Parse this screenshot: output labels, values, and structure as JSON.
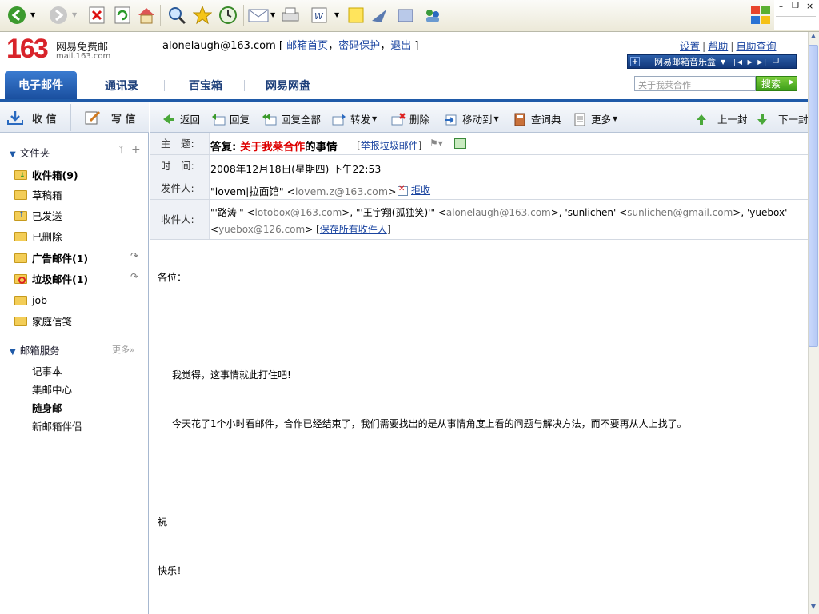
{
  "app": {
    "logo_number": "163",
    "logo_name": "网易免费邮",
    "logo_domain": "mail.163.com"
  },
  "user": {
    "email": "alonelaugh@163.com",
    "links": [
      "邮箱首页",
      "密码保护",
      "退出"
    ]
  },
  "top_links": [
    "设置",
    "帮助",
    "自助查询"
  ],
  "music_box": "网易邮箱音乐盒",
  "search": {
    "placeholder": "关于我莱合作",
    "button": "搜索"
  },
  "nav": {
    "tabs": [
      "电子邮件",
      "通讯录",
      "百宝箱",
      "网易网盘"
    ]
  },
  "sidebar": {
    "receive": "收 信",
    "compose": "写 信",
    "folders_title": "文件夹",
    "folders": [
      {
        "label": "收件箱(9)",
        "bold": true
      },
      {
        "label": "草稿箱",
        "bold": false
      },
      {
        "label": "已发送",
        "bold": false
      },
      {
        "label": "已删除",
        "bold": false
      },
      {
        "label": "广告邮件(1)",
        "bold": true
      },
      {
        "label": "垃圾邮件(1)",
        "bold": true
      },
      {
        "label": "job",
        "bold": false
      },
      {
        "label": "家庭信笺",
        "bold": false
      }
    ],
    "services_title": "邮箱服务",
    "services_more": "更多»",
    "services": [
      "记事本",
      "集邮中心",
      "随身邮",
      "新邮箱伴侣"
    ]
  },
  "toolbar": {
    "back": "返回",
    "reply": "回复",
    "reply_all": "回复全部",
    "forward": "转发",
    "delete": "删除",
    "move": "移动到",
    "dict": "查词典",
    "more": "更多",
    "prev": "上一封",
    "next": "下一封"
  },
  "email": {
    "subject_label": "主　题:",
    "subject_prefix": "答复:",
    "subject_highlight": "关于我莱合作",
    "subject_suffix": "的事情",
    "report_spam": "举报垃圾邮件",
    "time_label": "时　间:",
    "time": "2008年12月18日(星期四) 下午22:53",
    "from_label": "发件人:",
    "from_name": "\"lovem|拉面馆\" <",
    "from_email": "lovem.z@163.com",
    "from_end": ">",
    "reject": "拒收",
    "to_label": "收件人:",
    "to_line1_parts": [
      "\"'路涛'\" <",
      "lotobox@163.com",
      ">, \"'王宇翔(孤独笑)'\" <",
      "alonelaugh@163.com",
      ">, 'sunlichen' <",
      "sunlichen@gmail.com",
      ">, 'yuebox'"
    ],
    "to_line2_parts": [
      "<",
      "yuebox@126.com",
      ">  ["
    ],
    "save_recipients": "保存所有收件人",
    "body": {
      "greeting": "各位：",
      "line1": "我觉得，这事情就此打住吧!",
      "line2": "今天花了1个小时看邮件，合作已经结束了，我们需要找出的是从事情角度上看的问题与解决方法，而不要再从人上找了。",
      "closing1": "祝",
      "closing2": "快乐！"
    }
  }
}
